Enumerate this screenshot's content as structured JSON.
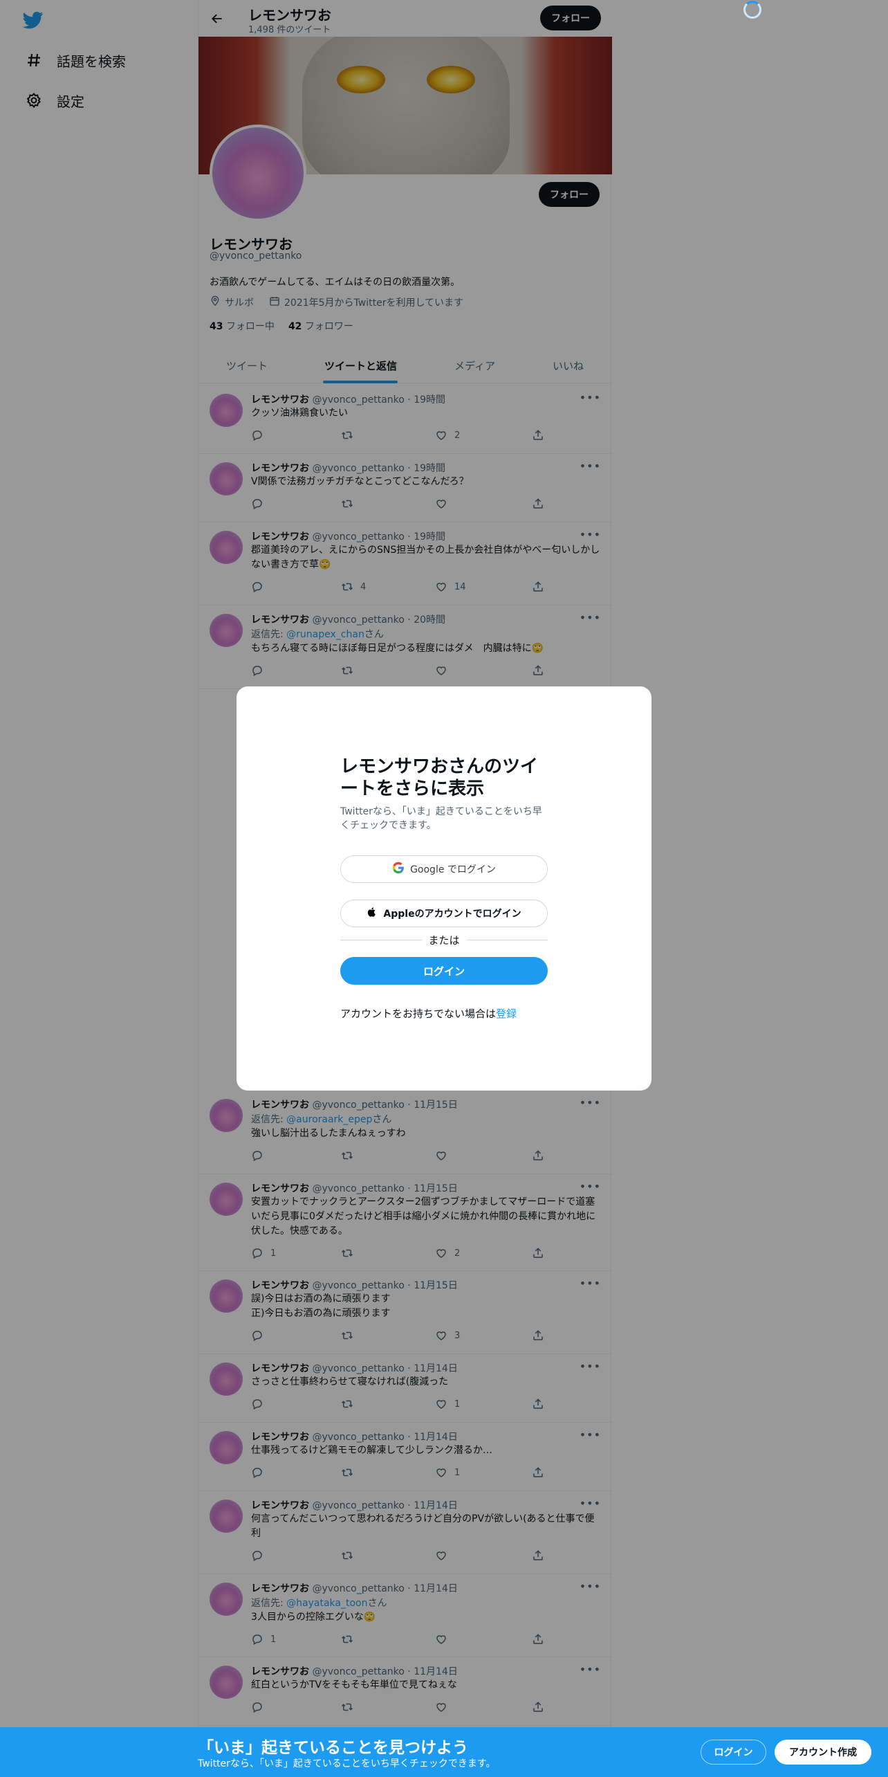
{
  "sidebar": {
    "items": [
      {
        "label": "話題を検索",
        "icon": "hashtag-icon"
      },
      {
        "label": "設定",
        "icon": "gear-icon"
      }
    ]
  },
  "header": {
    "name": "レモンサワお",
    "tweet_count": "1,498 件のツイート",
    "follow_label": "フォロー"
  },
  "profile": {
    "name": "レモンサワお",
    "handle": "@yvonco_pettanko",
    "bio": "お酒飲んでゲームしてる、エイムはその日の飲酒量次第。",
    "location": "サルボ",
    "joined": "2021年5月からTwitterを利用しています",
    "following_count": "43",
    "following_label": "フォロー中",
    "followers_count": "42",
    "followers_label": "フォロワー",
    "follow_label": "フォロー"
  },
  "tabs": [
    {
      "label": "ツイート"
    },
    {
      "label": "ツイートと返信"
    },
    {
      "label": "メディア"
    },
    {
      "label": "いいね"
    }
  ],
  "tweets": [
    {
      "name": "レモンサワお",
      "handle": "@yvonco_pettanko",
      "time": "19時間",
      "reply_to": "",
      "text": "クッソ油淋鶏食いたい",
      "replies": "",
      "retweets": "",
      "likes": "2"
    },
    {
      "name": "レモンサワお",
      "handle": "@yvonco_pettanko",
      "time": "19時間",
      "reply_to": "",
      "text": "V関係で法務ガッチガチなとこってどこなんだろ？",
      "replies": "",
      "retweets": "",
      "likes": ""
    },
    {
      "name": "レモンサワお",
      "handle": "@yvonco_pettanko",
      "time": "19時間",
      "reply_to": "",
      "text": "郡道美玲のアレ、えにからのSNS担当かその上長か会社自体がやべー匂いしかしない書き方で草🙄",
      "replies": "",
      "retweets": "4",
      "likes": "14"
    },
    {
      "name": "レモンサワお",
      "handle": "@yvonco_pettanko",
      "time": "20時間",
      "reply_to": "@runapex_chan",
      "text": "もちろん寝てる時にほぼ毎日足がつる程度にはダメ　内臓は特に🙄",
      "replies": "",
      "retweets": "",
      "likes": ""
    },
    {
      "name": "レモンサワお",
      "handle": "@yvonco_pettanko",
      "time": "11月15日",
      "reply_to": "@auroraark_epep",
      "text": "強いし脳汁出るしたまんねぇっすわ",
      "replies": "",
      "retweets": "",
      "likes": ""
    },
    {
      "name": "レモンサワお",
      "handle": "@yvonco_pettanko",
      "time": "11月15日",
      "reply_to": "",
      "text": "安置カットでナックラとアークスター2個ずつブチかましてマザーロードで道塞いだら見事に0ダメだったけど相手は縮小ダメに焼かれ仲間の長棒に貫かれ地に伏した。快感である。",
      "replies": "1",
      "retweets": "",
      "likes": "2"
    },
    {
      "name": "レモンサワお",
      "handle": "@yvonco_pettanko",
      "time": "11月15日",
      "reply_to": "",
      "text": "誤)今日はお酒の為に頑張ります\n正)今日もお酒の為に頑張ります",
      "replies": "",
      "retweets": "",
      "likes": "3"
    },
    {
      "name": "レモンサワお",
      "handle": "@yvonco_pettanko",
      "time": "11月14日",
      "reply_to": "",
      "text": "さっさと仕事終わらせて寝なければ(腹減った",
      "replies": "",
      "retweets": "",
      "likes": "1"
    },
    {
      "name": "レモンサワお",
      "handle": "@yvonco_pettanko",
      "time": "11月14日",
      "reply_to": "",
      "text": "仕事残ってるけど鶏モモの解凍して少しランク潜るか…",
      "replies": "",
      "retweets": "",
      "likes": "1"
    },
    {
      "name": "レモンサワお",
      "handle": "@yvonco_pettanko",
      "time": "11月14日",
      "reply_to": "",
      "text": "何言ってんだこいつって思われるだろうけど自分のPVが欲しい(あると仕事で便利",
      "replies": "",
      "retweets": "",
      "likes": ""
    },
    {
      "name": "レモンサワお",
      "handle": "@yvonco_pettanko",
      "time": "11月14日",
      "reply_to": "@hayataka_toon",
      "text": "3人目からの控除エグいな🙄",
      "replies": "1",
      "retweets": "",
      "likes": ""
    },
    {
      "name": "レモンサワお",
      "handle": "@yvonco_pettanko",
      "time": "11月14日",
      "reply_to": "",
      "text": "紅白というかTVをそもそも年単位で見てねぇな",
      "replies": "",
      "retweets": "",
      "likes": ""
    }
  ],
  "reply_prefix": "返信先: ",
  "reply_suffix": "さん",
  "modal": {
    "title": "レモンサワおさんのツイートをさらに表示",
    "subtitle": "Twitterなら、「いま」起きていることをいち早くチェックできます。",
    "google_label": "Google でログイン",
    "apple_label": "Appleのアカウントでログイン",
    "or_label": "または",
    "login_label": "ログイン",
    "footer_text": "アカウントをお持ちでない場合は",
    "signup_link": "登録"
  },
  "bottom_bar": {
    "title": "「いま」起きていることを見つけよう",
    "subtitle": "Twitterなら、「いま」起きていることをいち早くチェックできます。",
    "login_label": "ログイン",
    "signup_label": "アカウント作成"
  },
  "colors": {
    "accent": "#1d9bf0",
    "dark": "#0f1419",
    "muted": "#536471"
  }
}
